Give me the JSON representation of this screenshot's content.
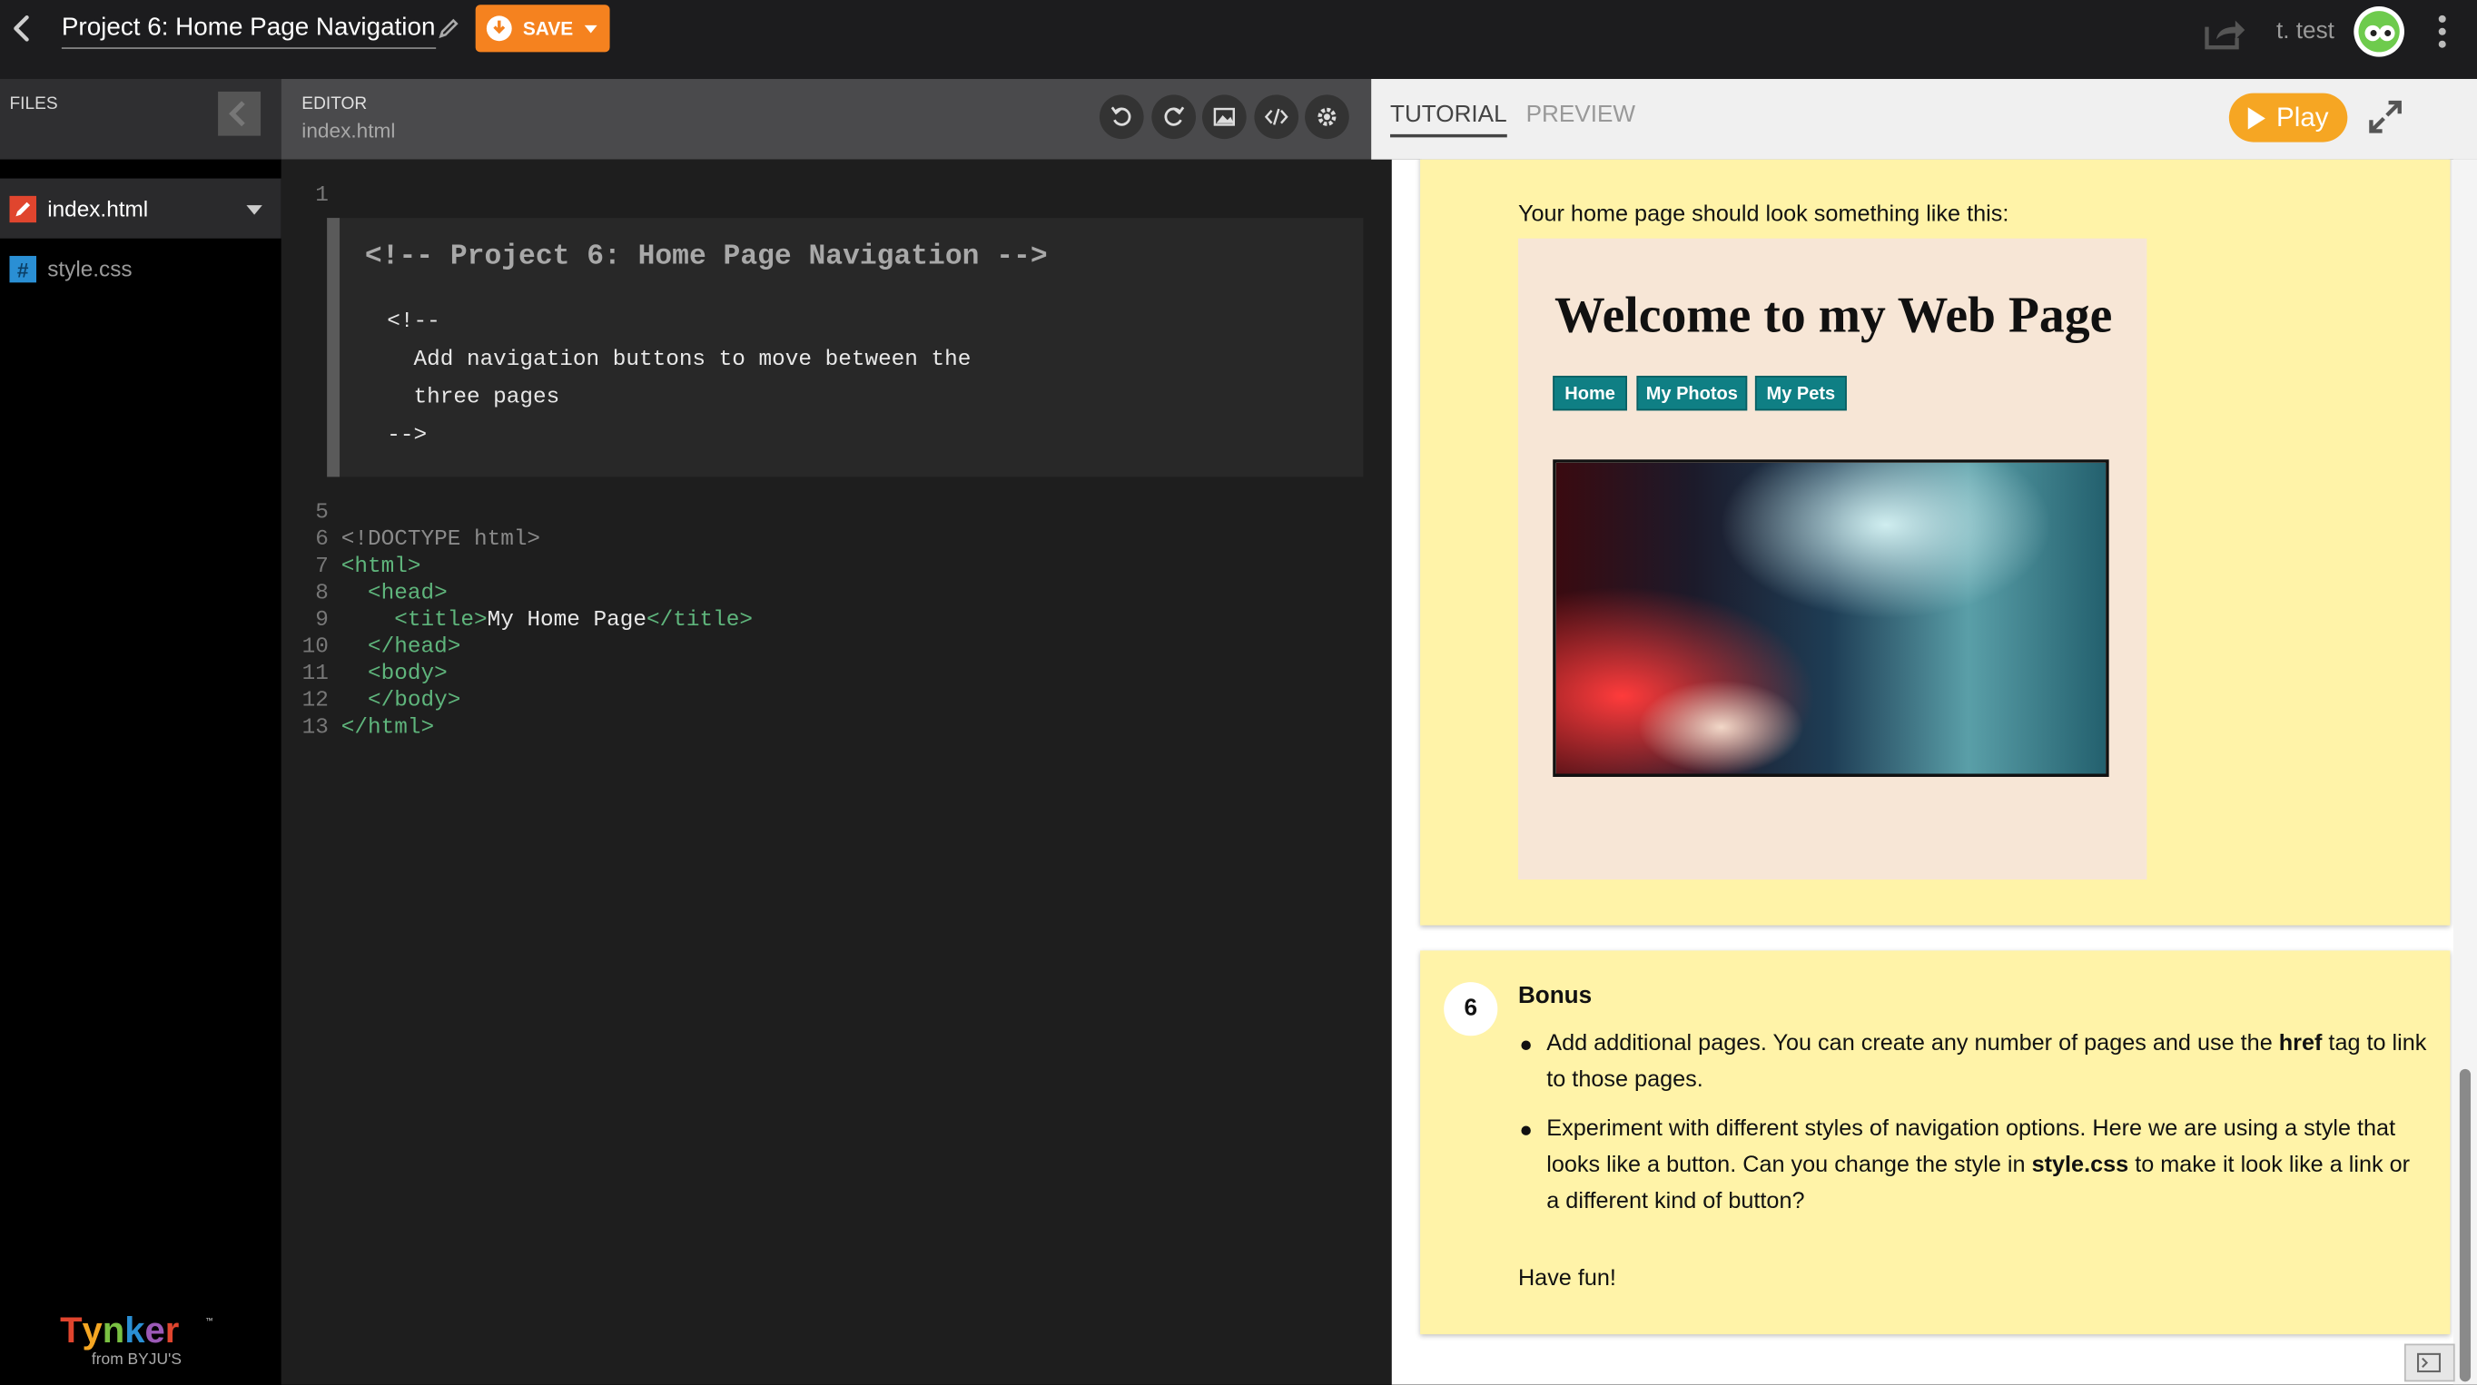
{
  "topbar": {
    "project_title": "Project 6: Home Page Navigation",
    "save_label": "SAVE",
    "username": "t. test"
  },
  "files": {
    "header": "FILES",
    "items": [
      {
        "name": "index.html",
        "icon": "html-file-icon",
        "icon_color": "#e0452e",
        "active": true
      },
      {
        "name": "style.css",
        "icon": "css-file-icon",
        "icon_color": "#2a8fd4",
        "active": false
      }
    ]
  },
  "brand": {
    "logo": "Tynker",
    "tagline": "from BYJU'S"
  },
  "editor": {
    "header_label": "EDITOR",
    "file_name": "index.html",
    "tools": [
      "undo-icon",
      "redo-icon",
      "image-icon",
      "code-icon",
      "gear-icon"
    ],
    "line_numbers": [
      "1",
      "5",
      "6",
      "7",
      "8",
      "9",
      "10",
      "11",
      "12",
      "13"
    ],
    "comment_block": {
      "title": "<!-- Project 6: Home Page Navigation -->",
      "lines": [
        "<!--",
        "  Add navigation buttons to move between the",
        "  three pages",
        "-->"
      ]
    },
    "code": {
      "l6": "<!DOCTYPE html>",
      "l7": "<html>",
      "l8": "  <head>",
      "l9_open": "    <title>",
      "l9_text": "My Home Page",
      "l9_close": "</title>",
      "l10": "  </head>",
      "l11": "  <body>",
      "l12": "  </body>",
      "l13": "</html>"
    }
  },
  "tabs": {
    "tutorial": "TUTORIAL",
    "preview": "PREVIEW",
    "play": "Play"
  },
  "tutorial": {
    "intro": "Your home page should look something like this:",
    "sample_page": {
      "title": "Welcome to my Web Page",
      "buttons": [
        "Home",
        "My Photos",
        "My Pets"
      ]
    },
    "step": {
      "number": "6",
      "title": "Bonus",
      "bullet1": [
        "Add additional pages. You can create any number of pages and use the ",
        "href",
        " tag to link to those pages."
      ],
      "bullet2": [
        "Experiment with different styles of navigation options. Here we are using a style that looks like a button. Can you change the style in ",
        "style.css",
        " to make it look like a link or a different kind of button?"
      ],
      "closing": "Have fun!"
    }
  },
  "colors": {
    "save": "#f5821f",
    "play": "#f6a623",
    "card": "#fff3a8",
    "code_tag": "#5fb57c"
  }
}
